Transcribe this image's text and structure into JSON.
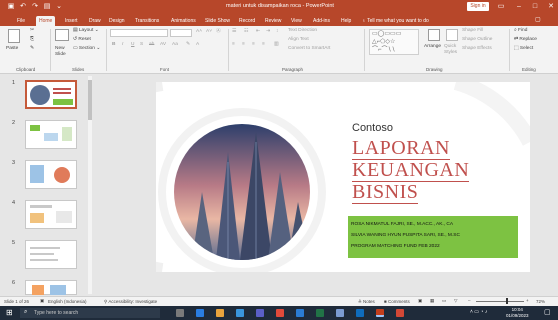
{
  "window": {
    "title": "materi untuk disampaikan roca - PowerPoint",
    "sign_in": "Sign in"
  },
  "menu": {
    "tabs": [
      "File",
      "Home",
      "Insert",
      "Draw",
      "Design",
      "Transitions",
      "Animations",
      "Slide Show",
      "Record",
      "Review",
      "View",
      "Add-ins",
      "Help"
    ],
    "active": "Home",
    "tell_me": "Tell me what you want to do"
  },
  "ribbon": {
    "groups": [
      "Clipboard",
      "Slides",
      "Font",
      "Paragraph",
      "Drawing",
      "Editing"
    ],
    "paste": "Paste",
    "new_slide": "New Slide",
    "layout": "Layout",
    "reset": "Reset",
    "section": "Section",
    "text_direction": "Text Direction",
    "align_text": "Align Text",
    "convert_smartart": "Convert to SmartArt",
    "arrange": "Arrange",
    "quick_styles": "Quick Styles",
    "shape_fill": "Shape Fill",
    "shape_outline": "Shape Outline",
    "shape_effects": "Shape Effects",
    "find": "Find",
    "replace": "Replace",
    "select": "Select"
  },
  "thumbnails": {
    "numbers": [
      "1",
      "2",
      "3",
      "4",
      "5",
      "6"
    ],
    "selected": "1"
  },
  "slide": {
    "logo": "Contoso",
    "title_lines": [
      "LAPORAN",
      "KEUANGAN",
      "BISNIS"
    ],
    "authors": [
      "ROSA NIKMATUL FAJRI, SE., M.ACC., AK., CA",
      "SILVIA WANING HYUN PUSPITA SARI, SE., M.SC",
      "PROGRAM MATCHING FUND FEB 2022"
    ],
    "accent_color": "#c0504d",
    "panel_color": "#7dc242"
  },
  "status": {
    "slide_of": "Slide 1 of 26",
    "language": "English (Indonesia)",
    "accessibility": "Accessibility: Investigate",
    "notes": "Notes",
    "comments": "Comments",
    "zoom": "72%"
  },
  "taskbar": {
    "search_placeholder": "Type here to search",
    "time": "10:04",
    "date": "01/09/2023"
  }
}
